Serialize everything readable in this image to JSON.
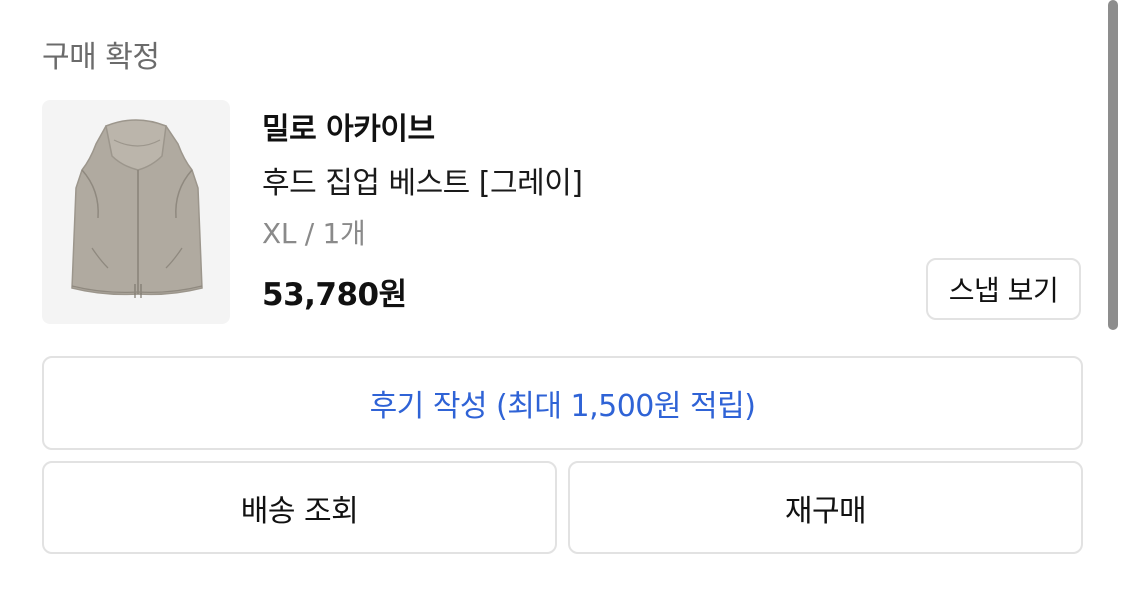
{
  "order": {
    "status_label": "구매 확정",
    "brand": "밀로 아카이브",
    "product_name": "후드 집업 베스트 [그레이]",
    "option": "XL / 1개",
    "price": "53,780원",
    "snap_button_label": "스냅 보기",
    "product_image_icon": "gray-hooded-vest-image"
  },
  "actions": {
    "review_label": "후기 작성 (최대 1,500원 적립)",
    "track_label": "배송 조회",
    "rebuy_label": "재구매"
  },
  "colors": {
    "review_accent": "#2f63d6",
    "status_text": "#6b6b6b",
    "option_text": "#8a8a8a",
    "border": "#e2e2e2",
    "image_bg": "#f4f4f4"
  }
}
